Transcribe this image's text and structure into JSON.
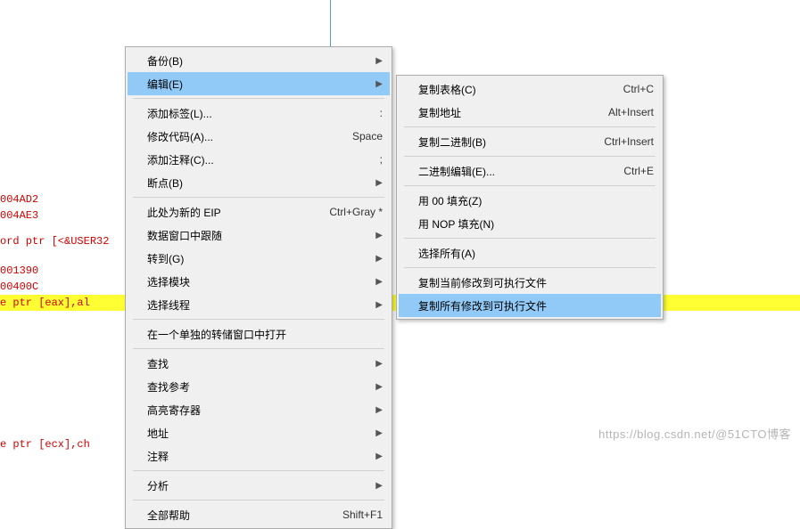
{
  "disasm": {
    "l1": "004AD2",
    "l2": "004AE3",
    "l3": "ord ptr [<&USER32",
    "l4": "001390",
    "l5": "00400C",
    "l6": "e ptr [eax],al",
    "l7": "e ptr [ecx],ch"
  },
  "menu1": {
    "backup": "备份(B)",
    "edit": "编辑(E)",
    "add_label": "添加标签(L)...",
    "add_label_sc": ":",
    "mod_code": "修改代码(A)...",
    "mod_code_sc": "Space",
    "add_comment": "添加注释(C)...",
    "add_comment_sc": ";",
    "breakpoint": "断点(B)",
    "new_eip": "此处为新的 EIP",
    "new_eip_sc": "Ctrl+Gray *",
    "follow_data": "数据窗口中跟随",
    "goto": "转到(G)",
    "select_module": "选择模块",
    "select_thread": "选择线程",
    "open_dump": "在一个单独的转储窗口中打开",
    "find": "查找",
    "find_ref": "查找参考",
    "hl_reg": "高亮寄存器",
    "addr": "地址",
    "comment": "注释",
    "analyze": "分析",
    "help_last_label": "全部帮助",
    "help_last_sc": "Shift+F1"
  },
  "menu2": {
    "copy_table": "复制表格(C)",
    "copy_table_sc": "Ctrl+C",
    "copy_addr": "复制地址",
    "copy_addr_sc": "Alt+Insert",
    "copy_bin": "复制二进制(B)",
    "copy_bin_sc": "Ctrl+Insert",
    "bin_edit": "二进制编辑(E)...",
    "bin_edit_sc": "Ctrl+E",
    "fill_00": "用 00 填充(Z)",
    "fill_nop": "用 NOP 填充(N)",
    "select_all": "选择所有(A)",
    "copy_cur_mod": "复制当前修改到可执行文件",
    "copy_all_mod": "复制所有修改到可执行文件"
  },
  "watermark": {
    "left": "https://blog.csdn.net/",
    "right": "@51CTO博客"
  }
}
